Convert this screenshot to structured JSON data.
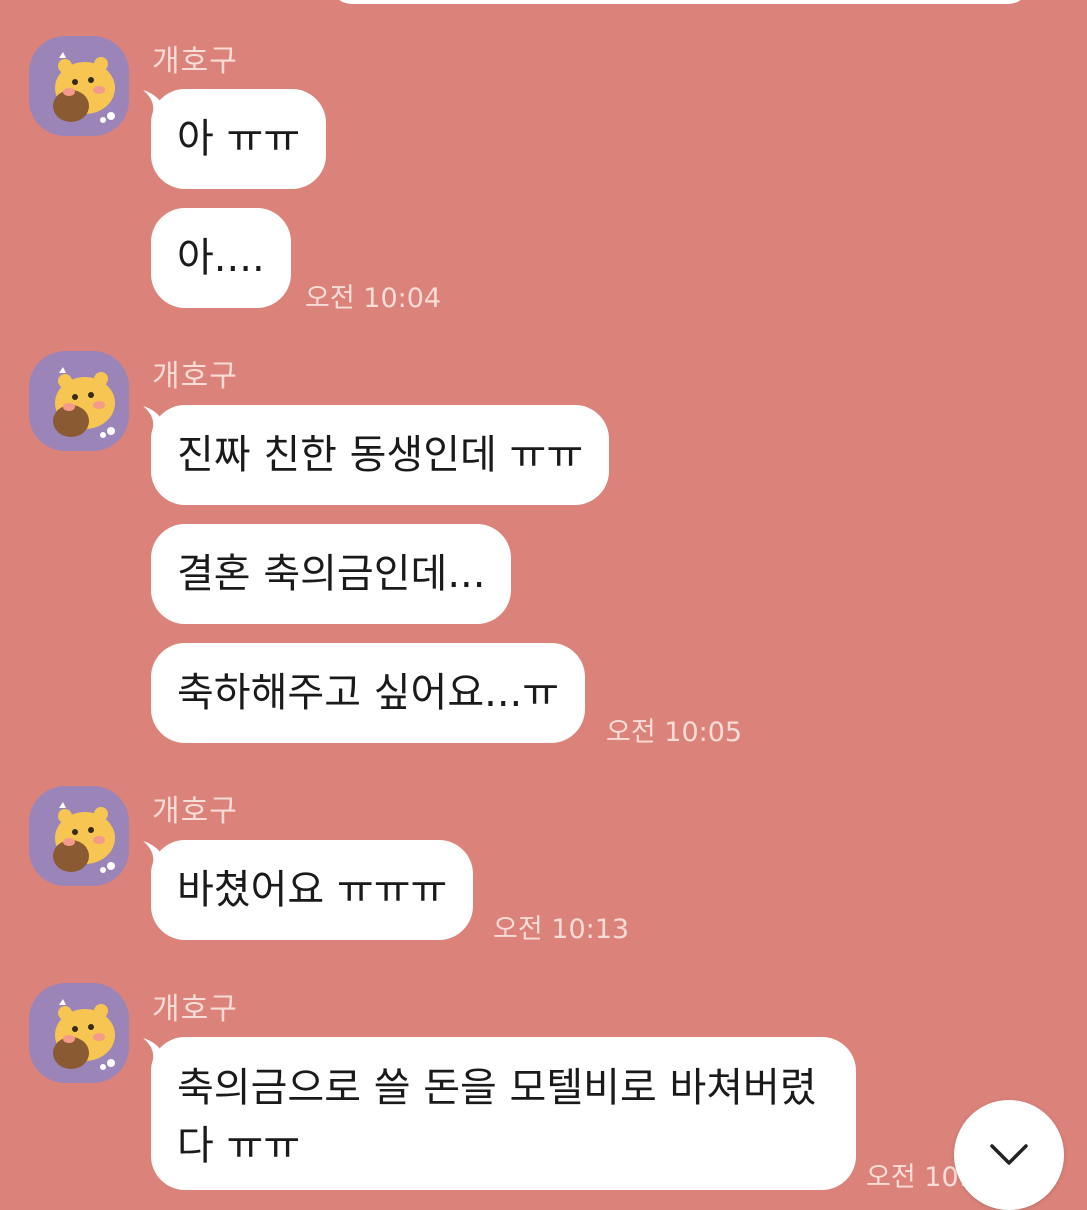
{
  "chat": {
    "groups": [
      {
        "sender": "개호구",
        "avatar_icon": "bear-character-avatar",
        "messages": [
          "아 ㅠㅠ",
          "아...."
        ],
        "time": "오전 10:04"
      },
      {
        "sender": "개호구",
        "avatar_icon": "bear-character-avatar",
        "messages": [
          "진짜 친한 동생인데 ㅠㅠ",
          "결혼 축의금인데...",
          "축하해주고 싶어요...ㅠ"
        ],
        "time": "오전 10:05"
      },
      {
        "sender": "개호구",
        "avatar_icon": "bear-character-avatar",
        "messages": [
          "바쳤어요 ㅠㅠㅠ"
        ],
        "time": "오전 10:13"
      },
      {
        "sender": "개호구",
        "avatar_icon": "bear-character-avatar",
        "messages": [
          "축의금으로 쓸 돈을 모텔비로 바쳐버렸다 ㅠㅠ"
        ],
        "time": "오전 10:"
      }
    ]
  },
  "scroll_button": {
    "icon": "chevron-down-icon"
  },
  "colors": {
    "background": "#db837a",
    "bubble": "#ffffff",
    "avatar_bg": "#9a84b8",
    "secondary_text": "#f7dcd7"
  }
}
